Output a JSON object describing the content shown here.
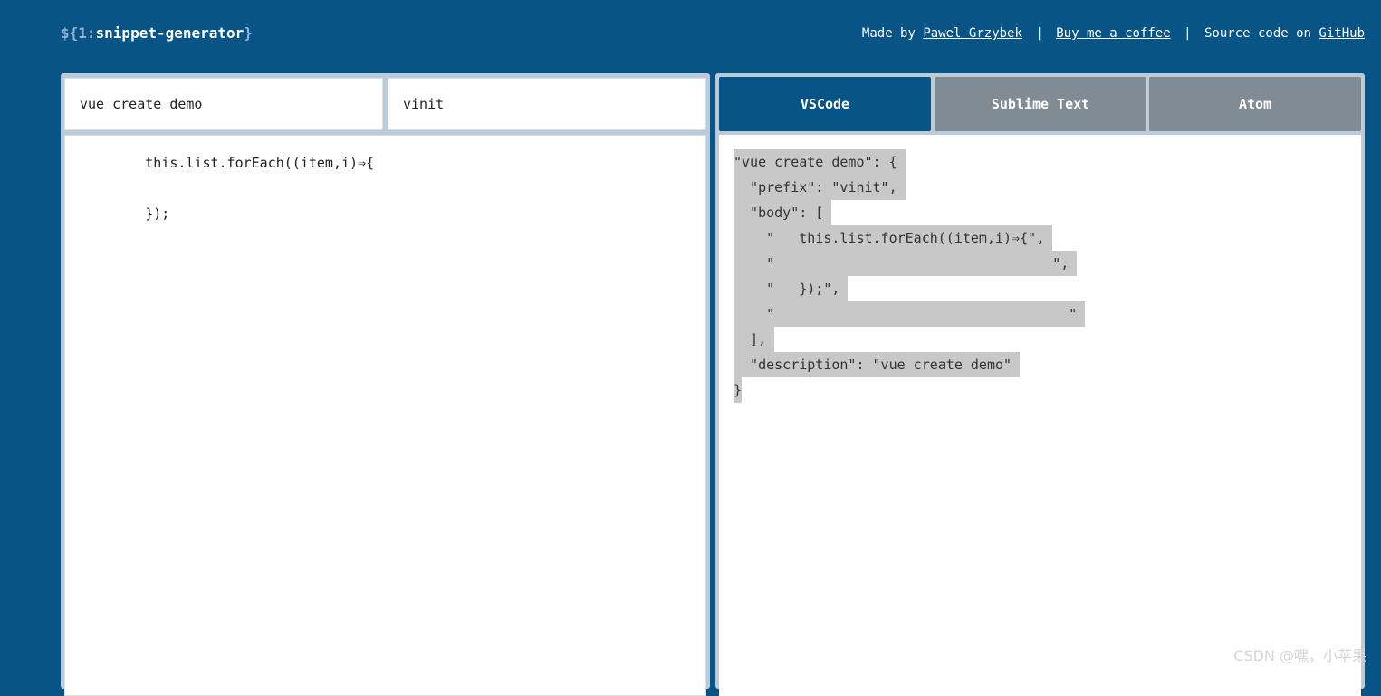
{
  "header": {
    "logo_prefix": "${1:",
    "logo_name": "snippet-generator",
    "logo_suffix": "}",
    "made_by_text": "Made by ",
    "author_link": "Pawel Grzybek",
    "separator": "|",
    "coffee_link": "Buy me a coffee",
    "source_text": "Source code on ",
    "github_link": "GitHub"
  },
  "inputs": {
    "description_value": "vue create demo",
    "tab_trigger_value": "vinit"
  },
  "editor": {
    "lines": [
      "        this.list.forEach((item,i)⇒{",
      "",
      "        });"
    ]
  },
  "tabs": [
    {
      "label": "VSCode",
      "active": true
    },
    {
      "label": "Sublime Text",
      "active": false
    },
    {
      "label": "Atom",
      "active": false
    }
  ],
  "output": {
    "lines": [
      "\"vue create demo\": { ",
      "  \"prefix\": \"vinit\", ",
      "  \"body\": [ ",
      "    \"   this.list.forEach((item,i)⇒{\", ",
      "    \"                                  \", ",
      "    \"   });\", ",
      "    \"                                    \" ",
      "  ], ",
      "  \"description\": \"vue create demo\" ",
      "}"
    ]
  },
  "watermark": "CSDN @嘿，小苹果",
  "colors": {
    "background": "#085486",
    "panel": "#bccbda",
    "tab_active": "#085486",
    "tab_inactive": "#808b93",
    "selection": "#c8c8c8"
  }
}
